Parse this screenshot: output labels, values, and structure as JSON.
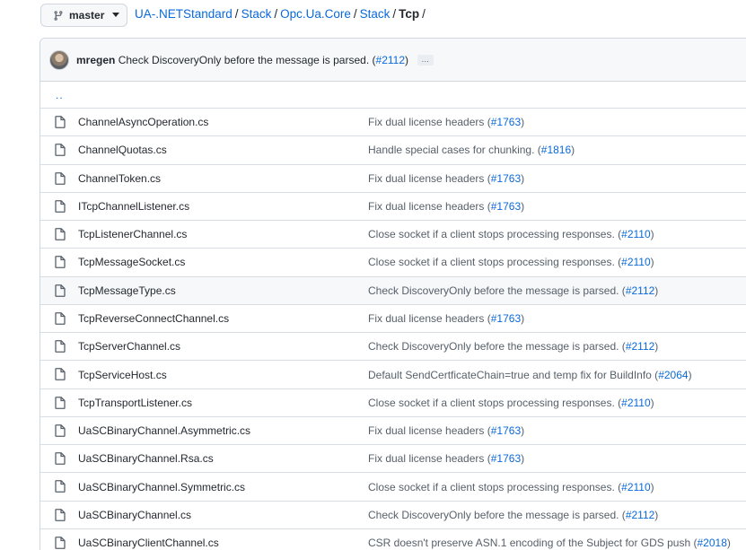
{
  "branch": {
    "name": "master"
  },
  "breadcrumb": {
    "repo": "UA-.NETStandard",
    "parts": [
      "Stack",
      "Opc.Ua.Core",
      "Stack"
    ],
    "current": "Tcp",
    "separator": "/"
  },
  "latest_commit": {
    "author": "mregen",
    "message": "Check DiscoveryOnly before the message is parsed.",
    "pr_open": "(",
    "pr": "#2112",
    "pr_close": ")",
    "ellipsis": "…"
  },
  "parent_dir": "..",
  "files": [
    {
      "name": "ChannelAsyncOperation.cs",
      "msg": "Fix dual license headers",
      "pr": "#1763",
      "suffix": ""
    },
    {
      "name": "ChannelQuotas.cs",
      "msg": "Handle special cases for chunking.",
      "pr": "#1816",
      "suffix": ""
    },
    {
      "name": "ChannelToken.cs",
      "msg": "Fix dual license headers",
      "pr": "#1763",
      "suffix": ""
    },
    {
      "name": "ITcpChannelListener.cs",
      "msg": "Fix dual license headers",
      "pr": "#1763",
      "suffix": ""
    },
    {
      "name": "TcpListenerChannel.cs",
      "msg": "Close socket if a client stops processing responses.",
      "pr": "#2110",
      "suffix": ""
    },
    {
      "name": "TcpMessageSocket.cs",
      "msg": "Close socket if a client stops processing responses.",
      "pr": "#2110",
      "suffix": ""
    },
    {
      "name": "TcpMessageType.cs",
      "msg": "Check DiscoveryOnly before the message is parsed.",
      "pr": "#2112",
      "suffix": "",
      "hover": true
    },
    {
      "name": "TcpReverseConnectChannel.cs",
      "msg": "Fix dual license headers",
      "pr": "#1763",
      "suffix": ""
    },
    {
      "name": "TcpServerChannel.cs",
      "msg": "Check DiscoveryOnly before the message is parsed.",
      "pr": "#2112",
      "suffix": ""
    },
    {
      "name": "TcpServiceHost.cs",
      "msg": "Default SendCertficateChain=true and temp fix for BuildInfo",
      "pr": "#2064",
      "suffix": ""
    },
    {
      "name": "TcpTransportListener.cs",
      "msg": "Close socket if a client stops processing responses.",
      "pr": "#2110",
      "suffix": ""
    },
    {
      "name": "UaSCBinaryChannel.Asymmetric.cs",
      "msg": "Fix dual license headers",
      "pr": "#1763",
      "suffix": ""
    },
    {
      "name": "UaSCBinaryChannel.Rsa.cs",
      "msg": "Fix dual license headers",
      "pr": "#1763",
      "suffix": ""
    },
    {
      "name": "UaSCBinaryChannel.Symmetric.cs",
      "msg": "Close socket if a client stops processing responses.",
      "pr": "#2110",
      "suffix": ""
    },
    {
      "name": "UaSCBinaryChannel.cs",
      "msg": "Check DiscoveryOnly before the message is parsed.",
      "pr": "#2112",
      "suffix": ""
    },
    {
      "name": "UaSCBinaryClientChannel.cs",
      "msg": "CSR doesn't preserve ASN.1 encoding of the Subject for GDS push",
      "pr": "#2018",
      "suffix": ""
    }
  ],
  "icons": {
    "branch": "git-branch-icon",
    "caret": "chevron-down-icon",
    "file": "file-icon"
  },
  "colors": {
    "link": "#0969da",
    "text": "#24292f",
    "muted": "#57606a",
    "border": "#d0d7de",
    "header_bg": "#f6f8fa"
  }
}
